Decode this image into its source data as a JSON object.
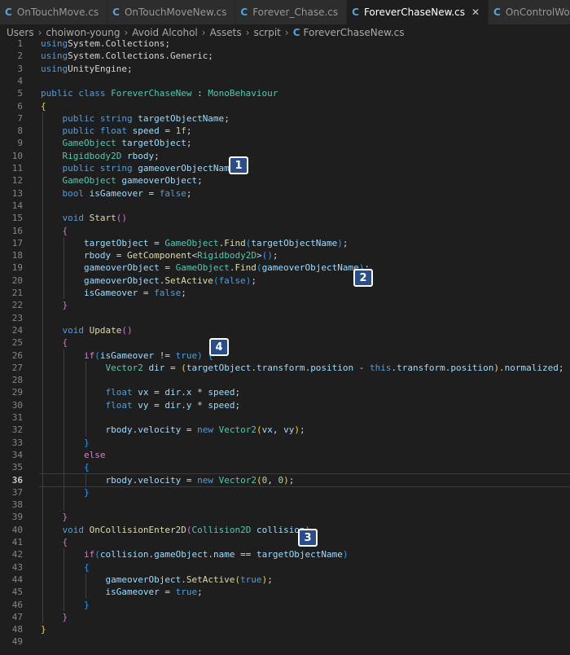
{
  "tabs": [
    {
      "label": "OnTouchMove.cs",
      "active": false,
      "closable": false
    },
    {
      "label": "OnTouchMoveNew.cs",
      "active": false,
      "closable": false
    },
    {
      "label": "Forever_Chase.cs",
      "active": false,
      "closable": false
    },
    {
      "label": "ForeverChaseNew.cs",
      "active": true,
      "closable": true
    },
    {
      "label": "OnControlWorld",
      "active": false,
      "closable": false
    }
  ],
  "breadcrumb": [
    "Users",
    "choiwon-young",
    "Avoid Alcohol",
    "Assets",
    "scrpit",
    "ForeverChaseNew.cs"
  ],
  "current_line": 36,
  "colors": {
    "keyword": "#569cd6",
    "type": "#4ec9b0",
    "function": "#dcdcaa",
    "variable": "#9cdcfe",
    "control": "#c586c0",
    "badge": "#2a4d8c"
  },
  "icons": {
    "file": "csharp-file-icon",
    "close": "close-icon"
  },
  "badges": [
    {
      "label": "1"
    },
    {
      "label": "2"
    },
    {
      "label": "3"
    },
    {
      "label": "4"
    }
  ],
  "lines": [
    {
      "n": "1",
      "tokens": [
        [
          "kw",
          "using"
        ],
        [
          "",
          "System.Collections;"
        ]
      ]
    },
    {
      "n": "2",
      "tokens": [
        [
          "kw",
          "using"
        ],
        [
          "",
          "System.Collections.Generic;"
        ]
      ]
    },
    {
      "n": "3",
      "tokens": [
        [
          "kw",
          "using"
        ],
        [
          "",
          "UnityEngine;"
        ]
      ]
    },
    {
      "n": "4",
      "tokens": []
    },
    {
      "n": "5",
      "tokens": [
        [
          "kw",
          "public class"
        ],
        [
          "ty",
          "ForeverChaseNew"
        ],
        [
          "",
          " : "
        ],
        [
          "ty",
          "MonoBehaviour"
        ]
      ]
    },
    {
      "n": "6",
      "tokens": [
        [
          "y1",
          "{"
        ]
      ]
    },
    {
      "n": "7",
      "tokens": [
        [
          "",
          "    "
        ],
        [
          "kw",
          "public string"
        ],
        [
          "var",
          "targetObjectName"
        ],
        [
          "",
          ";"
        ]
      ]
    },
    {
      "n": "8",
      "tokens": [
        [
          "",
          "    "
        ],
        [
          "kw",
          "public float"
        ],
        [
          "var",
          "speed"
        ],
        [
          "",
          " = "
        ],
        [
          "num",
          "1f"
        ],
        [
          "",
          ";"
        ]
      ]
    },
    {
      "n": "9",
      "tokens": [
        [
          "",
          "    "
        ],
        [
          "ty",
          "GameObject"
        ],
        [
          "var",
          "targetObject"
        ],
        [
          "",
          ";"
        ]
      ]
    },
    {
      "n": "10",
      "tokens": [
        [
          "",
          "    "
        ],
        [
          "ty",
          "Rigidbody2D"
        ],
        [
          "var",
          "rbody"
        ],
        [
          "",
          ";"
        ]
      ]
    },
    {
      "n": "11",
      "tokens": [
        [
          "",
          "    "
        ],
        [
          "kw",
          "public string"
        ],
        [
          "var",
          "gameoverObjectName"
        ],
        [
          "",
          ";"
        ]
      ]
    },
    {
      "n": "12",
      "tokens": [
        [
          "",
          "    "
        ],
        [
          "ty",
          "GameObject"
        ],
        [
          "var",
          "gameoverObject"
        ],
        [
          "",
          ";"
        ]
      ]
    },
    {
      "n": "13",
      "tokens": [
        [
          "",
          "    "
        ],
        [
          "kw",
          "bool"
        ],
        [
          "var",
          "isGameover"
        ],
        [
          "",
          " = "
        ],
        [
          "kw",
          "false"
        ],
        [
          "",
          ";"
        ]
      ]
    },
    {
      "n": "14",
      "tokens": []
    },
    {
      "n": "15",
      "tokens": [
        [
          "",
          "    "
        ],
        [
          "kw",
          "void"
        ],
        [
          "fn",
          "Start"
        ],
        [
          "y2",
          "()"
        ]
      ]
    },
    {
      "n": "16",
      "tokens": [
        [
          "",
          "    "
        ],
        [
          "y2",
          "{"
        ]
      ]
    },
    {
      "n": "17",
      "tokens": [
        [
          "",
          "        "
        ],
        [
          "var",
          "targetObject"
        ],
        [
          "",
          " = "
        ],
        [
          "ty",
          "GameObject"
        ],
        [
          "",
          "."
        ],
        [
          "fn",
          "Find"
        ],
        [
          "y3",
          "("
        ],
        [
          "var",
          "targetObjectName"
        ],
        [
          "y3",
          ")"
        ],
        [
          "",
          ";"
        ]
      ]
    },
    {
      "n": "18",
      "tokens": [
        [
          "",
          "        "
        ],
        [
          "var",
          "rbody"
        ],
        [
          "",
          " = "
        ],
        [
          "fn",
          "GetComponent"
        ],
        [
          "",
          "<"
        ],
        [
          "ty",
          "Rigidbody2D"
        ],
        [
          "",
          ">"
        ],
        [
          "y3",
          "()"
        ],
        [
          "",
          ";"
        ]
      ]
    },
    {
      "n": "19",
      "tokens": [
        [
          "",
          "        "
        ],
        [
          "var",
          "gameoverObject"
        ],
        [
          "",
          " = "
        ],
        [
          "ty",
          "GameObject"
        ],
        [
          "",
          "."
        ],
        [
          "fn",
          "Find"
        ],
        [
          "y3",
          "("
        ],
        [
          "var",
          "gameoverObjectName"
        ],
        [
          "y3",
          ")"
        ],
        [
          "",
          ";"
        ]
      ]
    },
    {
      "n": "20",
      "tokens": [
        [
          "",
          "        "
        ],
        [
          "var",
          "gameoverObject"
        ],
        [
          "",
          "."
        ],
        [
          "fn",
          "SetActive"
        ],
        [
          "y3",
          "("
        ],
        [
          "kw",
          "false"
        ],
        [
          "y3",
          ")"
        ],
        [
          "",
          ";"
        ]
      ]
    },
    {
      "n": "21",
      "tokens": [
        [
          "",
          "        "
        ],
        [
          "var",
          "isGameover"
        ],
        [
          "",
          " = "
        ],
        [
          "kw",
          "false"
        ],
        [
          "",
          ";"
        ]
      ]
    },
    {
      "n": "22",
      "tokens": [
        [
          "",
          "    "
        ],
        [
          "y2",
          "}"
        ]
      ]
    },
    {
      "n": "23",
      "tokens": []
    },
    {
      "n": "24",
      "tokens": [
        [
          "",
          "    "
        ],
        [
          "kw",
          "void"
        ],
        [
          "fn",
          "Update"
        ],
        [
          "y2",
          "()"
        ]
      ]
    },
    {
      "n": "25",
      "tokens": [
        [
          "",
          "    "
        ],
        [
          "y2",
          "{"
        ]
      ]
    },
    {
      "n": "26",
      "tokens": [
        [
          "",
          "        "
        ],
        [
          "ctl",
          "if"
        ],
        [
          "y3",
          "("
        ],
        [
          "var",
          "isGameover"
        ],
        [
          "",
          " != "
        ],
        [
          "kw",
          "true"
        ],
        [
          "y3",
          ")"
        ],
        [
          "",
          " "
        ],
        [
          "y3",
          "{"
        ]
      ]
    },
    {
      "n": "27",
      "tokens": [
        [
          "",
          "            "
        ],
        [
          "ty",
          "Vector2"
        ],
        [
          "var",
          "dir"
        ],
        [
          "",
          " = "
        ],
        [
          "y1",
          "("
        ],
        [
          "var",
          "targetObject"
        ],
        [
          "",
          "."
        ],
        [
          "var",
          "transform"
        ],
        [
          "",
          "."
        ],
        [
          "var",
          "position"
        ],
        [
          "",
          " - "
        ],
        [
          "kw",
          "this"
        ],
        [
          "",
          "."
        ],
        [
          "var",
          "transform"
        ],
        [
          "",
          "."
        ],
        [
          "var",
          "position"
        ],
        [
          "y1",
          ")"
        ],
        [
          "",
          "."
        ],
        [
          "var",
          "normalized"
        ],
        [
          "",
          ";"
        ]
      ]
    },
    {
      "n": "28",
      "tokens": []
    },
    {
      "n": "29",
      "tokens": [
        [
          "",
          "            "
        ],
        [
          "kw",
          "float"
        ],
        [
          "var",
          "vx"
        ],
        [
          "",
          " = "
        ],
        [
          "var",
          "dir"
        ],
        [
          "",
          "."
        ],
        [
          "var",
          "x"
        ],
        [
          "",
          " * "
        ],
        [
          "var",
          "speed"
        ],
        [
          "",
          ";"
        ]
      ]
    },
    {
      "n": "30",
      "tokens": [
        [
          "",
          "            "
        ],
        [
          "kw",
          "float"
        ],
        [
          "var",
          "vy"
        ],
        [
          "",
          " = "
        ],
        [
          "var",
          "dir"
        ],
        [
          "",
          "."
        ],
        [
          "var",
          "y"
        ],
        [
          "",
          " * "
        ],
        [
          "var",
          "speed"
        ],
        [
          "",
          ";"
        ]
      ]
    },
    {
      "n": "31",
      "tokens": []
    },
    {
      "n": "32",
      "tokens": [
        [
          "",
          "            "
        ],
        [
          "var",
          "rbody"
        ],
        [
          "",
          "."
        ],
        [
          "var",
          "velocity"
        ],
        [
          "",
          " = "
        ],
        [
          "kw",
          "new"
        ],
        [
          "ty",
          "Vector2"
        ],
        [
          "y1",
          "("
        ],
        [
          "var",
          "vx"
        ],
        [
          "",
          ", "
        ],
        [
          "var",
          "vy"
        ],
        [
          "y1",
          ")"
        ],
        [
          "",
          ";"
        ]
      ]
    },
    {
      "n": "33",
      "tokens": [
        [
          "",
          "        "
        ],
        [
          "y3",
          "}"
        ]
      ]
    },
    {
      "n": "34",
      "tokens": [
        [
          "",
          "        "
        ],
        [
          "ctl",
          "else"
        ]
      ]
    },
    {
      "n": "35",
      "tokens": [
        [
          "",
          "        "
        ],
        [
          "y3",
          "{"
        ]
      ]
    },
    {
      "n": "36",
      "tokens": [
        [
          "",
          "            "
        ],
        [
          "var",
          "rbody"
        ],
        [
          "",
          "."
        ],
        [
          "var",
          "velocity"
        ],
        [
          "",
          " = "
        ],
        [
          "kw",
          "new"
        ],
        [
          "ty",
          "Vector2"
        ],
        [
          "y1",
          "("
        ],
        [
          "num",
          "0"
        ],
        [
          "",
          ", "
        ],
        [
          "num",
          "0"
        ],
        [
          "y1",
          ")"
        ],
        [
          "",
          ";"
        ]
      ]
    },
    {
      "n": "37",
      "tokens": [
        [
          "",
          "        "
        ],
        [
          "y3",
          "}"
        ]
      ]
    },
    {
      "n": "38",
      "tokens": []
    },
    {
      "n": "39",
      "tokens": [
        [
          "",
          "    "
        ],
        [
          "y2",
          "}"
        ]
      ]
    },
    {
      "n": "40",
      "tokens": [
        [
          "",
          "    "
        ],
        [
          "kw",
          "void"
        ],
        [
          "fn",
          "OnCollisionEnter2D"
        ],
        [
          "y2",
          "("
        ],
        [
          "ty",
          "Collision2D"
        ],
        [
          "var",
          "collision"
        ],
        [
          "y2",
          ")"
        ]
      ]
    },
    {
      "n": "41",
      "tokens": [
        [
          "",
          "    "
        ],
        [
          "y2",
          "{"
        ]
      ]
    },
    {
      "n": "42",
      "tokens": [
        [
          "",
          "        "
        ],
        [
          "ctl",
          "if"
        ],
        [
          "y3",
          "("
        ],
        [
          "var",
          "collision"
        ],
        [
          "",
          "."
        ],
        [
          "var",
          "gameObject"
        ],
        [
          "",
          "."
        ],
        [
          "var",
          "name"
        ],
        [
          "",
          " == "
        ],
        [
          "var",
          "targetObjectName"
        ],
        [
          "y3",
          ")"
        ]
      ]
    },
    {
      "n": "43",
      "tokens": [
        [
          "",
          "        "
        ],
        [
          "y3",
          "{"
        ]
      ]
    },
    {
      "n": "44",
      "tokens": [
        [
          "",
          "            "
        ],
        [
          "var",
          "gameoverObject"
        ],
        [
          "",
          "."
        ],
        [
          "fn",
          "SetActive"
        ],
        [
          "y1",
          "("
        ],
        [
          "kw",
          "true"
        ],
        [
          "y1",
          ")"
        ],
        [
          "",
          ";"
        ]
      ]
    },
    {
      "n": "45",
      "tokens": [
        [
          "",
          "            "
        ],
        [
          "var",
          "isGameover"
        ],
        [
          "",
          " = "
        ],
        [
          "kw",
          "true"
        ],
        [
          "",
          ";"
        ]
      ]
    },
    {
      "n": "46",
      "tokens": [
        [
          "",
          "        "
        ],
        [
          "y3",
          "}"
        ]
      ]
    },
    {
      "n": "47",
      "tokens": [
        [
          "",
          "    "
        ],
        [
          "y2",
          "}"
        ]
      ]
    },
    {
      "n": "48",
      "tokens": [
        [
          "y1",
          "}"
        ]
      ]
    },
    {
      "n": "49",
      "tokens": []
    }
  ]
}
